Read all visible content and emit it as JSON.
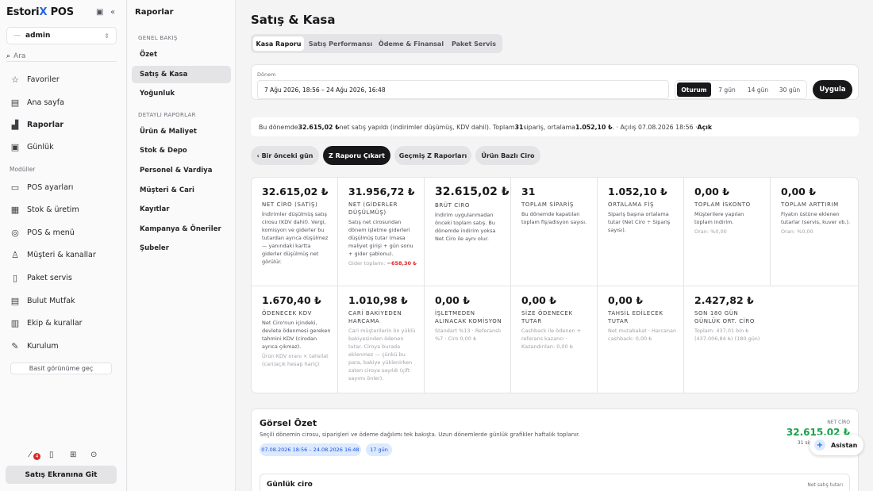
{
  "app": {
    "logo_a": "Estori",
    "logo_x": "X",
    "logo_b": " POS"
  },
  "sidebar": {
    "user": "admin",
    "search_placeholder": "Ara",
    "search_value": "Ara",
    "items": [
      {
        "label": "Favoriler",
        "icon": "star-icon",
        "glyph": "☆"
      },
      {
        "label": "Ana sayfa",
        "icon": "building-icon",
        "glyph": "▤"
      },
      {
        "label": "Raporlar",
        "icon": "chart-icon",
        "glyph": "▟"
      },
      {
        "label": "Günlük",
        "icon": "calendar-icon",
        "glyph": "▣"
      }
    ],
    "modules_label": "Modüller",
    "modules": [
      {
        "label": "POS ayarları",
        "icon": "card-icon",
        "glyph": "▭"
      },
      {
        "label": "Stok & üretim",
        "icon": "stock-icon",
        "glyph": "▦"
      },
      {
        "label": "POS & menü",
        "icon": "compass-icon",
        "glyph": "◎"
      },
      {
        "label": "Müşteri & kanallar",
        "icon": "user-icon",
        "glyph": "♙"
      },
      {
        "label": "Paket servis",
        "icon": "map-icon",
        "glyph": "▯"
      },
      {
        "label": "Bulut Mutfak",
        "icon": "cloud-kitchen-icon",
        "glyph": "▤"
      },
      {
        "label": "Ekip & kurallar",
        "icon": "team-icon",
        "glyph": "▥"
      },
      {
        "label": "Kurulum",
        "icon": "edit-icon",
        "glyph": "✎"
      }
    ],
    "basit": "Basit görünüme geç",
    "badge": "4",
    "satis_button": "Satış Ekranına Git"
  },
  "subnav": {
    "title": "Raporlar",
    "genel": "GENEL BAKIŞ",
    "genel_items": [
      "Özet",
      "Satış & Kasa",
      "Yoğunluk"
    ],
    "detay": "DETAYLI RAPORLAR",
    "detay_items": [
      "Ürün & Maliyet",
      "Stok & Depo",
      "Personel & Vardiya",
      "Müşteri & Cari",
      "Kayıtlar",
      "Kampanya & Öneriler",
      "Şubeler"
    ]
  },
  "main": {
    "title": "Satış & Kasa",
    "tabs": [
      "Kasa Raporu",
      "Satış Performansı",
      "Ödeme & Finansal",
      "Paket Servis"
    ],
    "donem_label": "Dönem",
    "donem_value": "7 Ağu 2026, 18:56 – 24 Ağu 2026, 16:48",
    "segments": [
      "Oturum",
      "7 gün",
      "14 gün",
      "30 gün"
    ],
    "uygula": "Uygula",
    "info": {
      "p1": "Bu dönemde ",
      "b1": "32.615,02 ₺",
      "p2": " net satış yapıldı (indirimler düşümüş, KDV dahil). Toplam ",
      "b2": "31",
      "p3": " sipariş, ortalama ",
      "b3": "1.052,10 ₺",
      "p4": ". · Açılış 07.08.2026 18:56 · ",
      "b4": "Açık"
    },
    "actions": [
      "‹ Bir önceki gün",
      "Z Raporu Çıkart",
      "Geçmiş Z Raporları",
      "Ürün Bazlı Ciro"
    ],
    "cards": [
      {
        "value": "32.615,02 ₺",
        "title": "NET CİRO (SATIŞ)",
        "desc": "İndirimler düşülmüş satış cirosu (KDV dahil). Vergi, komisyon ve giderler bu tutardan ayrıca düşülmez — yanındaki kartta giderler düşülmüş net görülür.",
        "extra": ""
      },
      {
        "value": "31.956,72 ₺",
        "title": "NET (GİDERLER DÜŞÜLMÜŞ)",
        "desc": "Satış net cirosundan dönem işletme giderleri düşülmüş tutar (masa maliyet girişi + gün sonu + gider şablonu).",
        "extra": "Gider toplamı: ",
        "extra_red": "−658,30 ₺"
      },
      {
        "value": "32.615,02 ₺",
        "title": "BRÜT CİRO",
        "desc": "İndirim uygulanmadan önceki toplam satış. Bu dönemde indirim yoksa Net Ciro ile aynı olur.",
        "extra": ""
      },
      {
        "value": "31",
        "title": "TOPLAM SİPARİŞ",
        "desc": "Bu dönemde kapatılan toplam fiş/adisyon sayısı.",
        "extra": ""
      },
      {
        "value": "1.052,10 ₺",
        "title": "ORTALAMA FİŞ",
        "desc": "Sipariş başına ortalama tutar (Net Ciro ÷ Sipariş sayısı).",
        "extra": ""
      },
      {
        "value": "0,00 ₺",
        "title": "TOPLAM İSKONTO",
        "desc": "Müşterilere yapılan toplam indirim.",
        "extra": "Oran: %0,00"
      },
      {
        "value": "0,00 ₺",
        "title": "TOPLAM ARTTIRIM",
        "desc": "Fiyatın üstüne eklenen tutarlar (servis, kuver vb.).",
        "extra": "Oran: %0,00"
      },
      {
        "value": "1.670,40 ₺",
        "title": "ÖDENECEK KDV",
        "desc": "Net Ciro'nun içindeki, devlete ödenmesi gereken tahmini KDV (cirodan ayrıca çıkmaz).",
        "extra": "Ürün KDV oranı × tahsilat (cari/açık hesap hariç)"
      },
      {
        "value": "1.010,98 ₺",
        "title": "CARİ BAKİYEDEN HARCAMA",
        "desc": "",
        "extra": "Cari müşterilerin ön yüklü bakiyesinden ödenen tutar. Ciroya burada eklenmez — çünkü bu para, bakiye yüklenirken zaten ciroya sayıldı (çift sayımı önler)."
      },
      {
        "value": "0,00 ₺",
        "title": "İŞLETMEDEN ALINACAK KOMİSYON",
        "desc": "",
        "extra": "Standart %13 · Referanslı %7 · Ciro 0,00 ₺"
      },
      {
        "value": "0,00 ₺",
        "title": "SİZE ÖDENECEK TUTAR",
        "desc": "",
        "extra": "Cashback ile ödenen + referans kazancı · Kazandırılan: 0,00 ₺"
      },
      {
        "value": "0,00 ₺",
        "title": "TAHSİL EDİLECEK TUTAR",
        "desc": "",
        "extra": "Net mutabakat · Harcanan cashback: 0,00 ₺"
      },
      {
        "value": "2.427,82 ₺",
        "title": "SON 180 GÜN GÜNLÜK ORT. CİRO",
        "desc": "",
        "extra": "Toplam: 437,01 bin ₺ (437.006,84 ₺) (180 gün)"
      }
    ],
    "gorsel": {
      "title": "Görsel Özet",
      "desc": "Seçili dönemin cirosu, siparişleri ve ödeme dağılımı tek bakışta. Uzun dönemlerde günlük grafikler haftalık toplanır.",
      "chip1": "07.08.2026 18:56 – 24.08.2026 16:48",
      "chip2": "17 gün",
      "net_label": "NET CİRO",
      "net_value": "32.615,02 ₺",
      "orders_short": "31 sipariş",
      "gunluk_title": "Günlük ciro",
      "gunluk_right": "Net satış tutarı"
    },
    "asistan": "Asistan"
  },
  "colors": {
    "accent": "#2563eb",
    "green": "#16a34a",
    "red": "#dc2626",
    "dark": "#18181b"
  }
}
